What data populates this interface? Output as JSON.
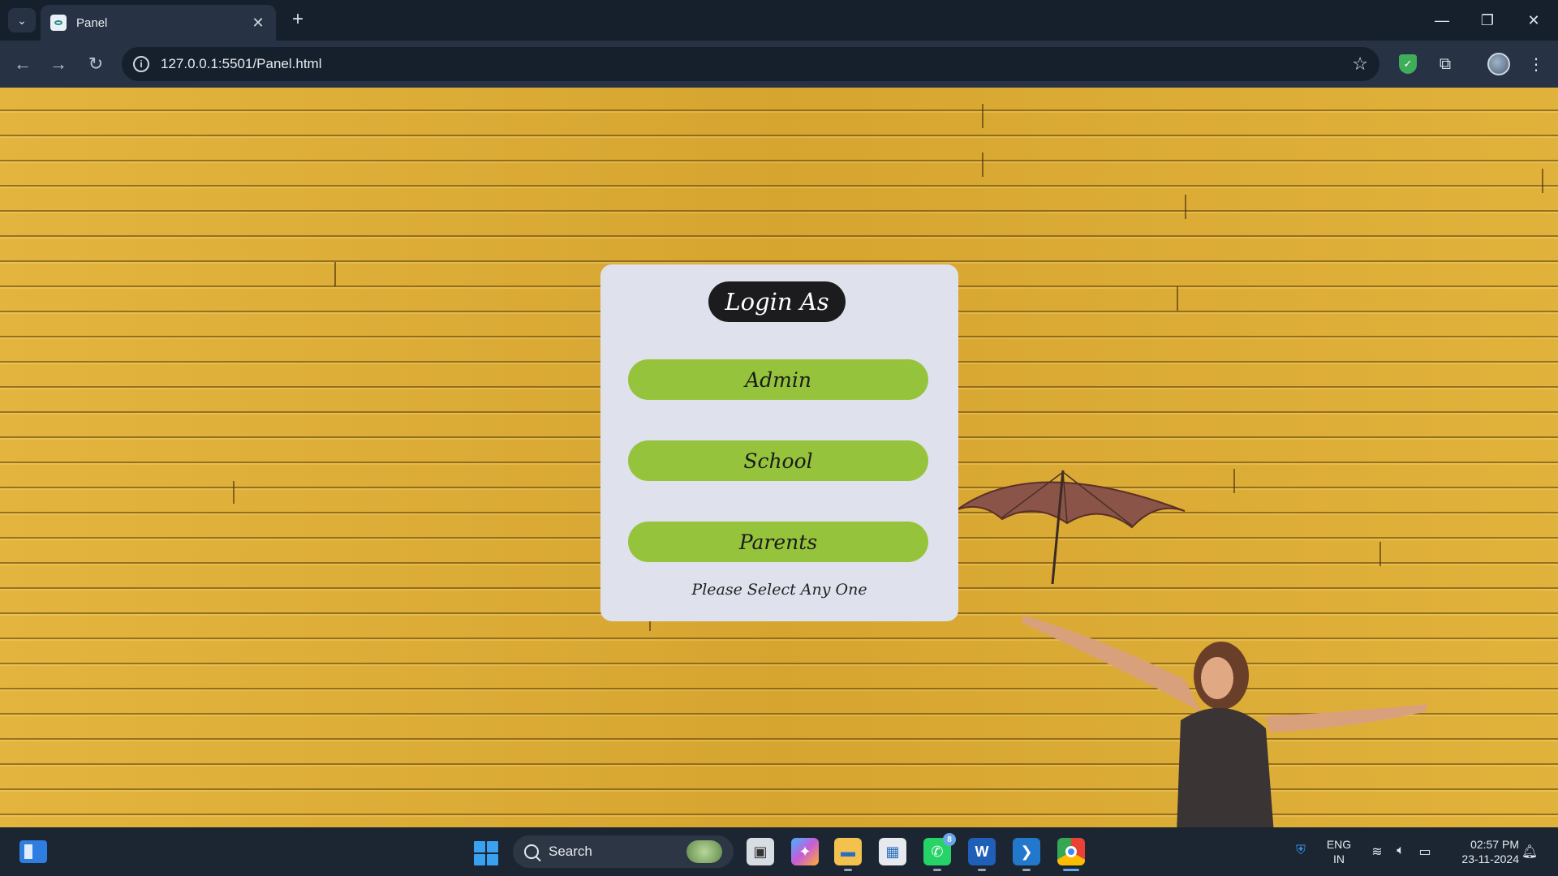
{
  "browser": {
    "tab_title": "Panel",
    "url": "127.0.0.1:5501/Panel.html"
  },
  "card": {
    "title": "Login As",
    "buttons": [
      "Admin",
      "School",
      "Parents"
    ],
    "hint": "Please Select Any One"
  },
  "taskbar": {
    "search_label": "Search",
    "whatsapp_badge": "8",
    "lang_line1": "ENG",
    "lang_line2": "IN",
    "time": "02:57 PM",
    "date": "23-11-2024"
  },
  "colors": {
    "wall": "#deae34",
    "card": "#dfe1ec",
    "button": "#95c43c",
    "title_pill": "#1c1c1e"
  }
}
